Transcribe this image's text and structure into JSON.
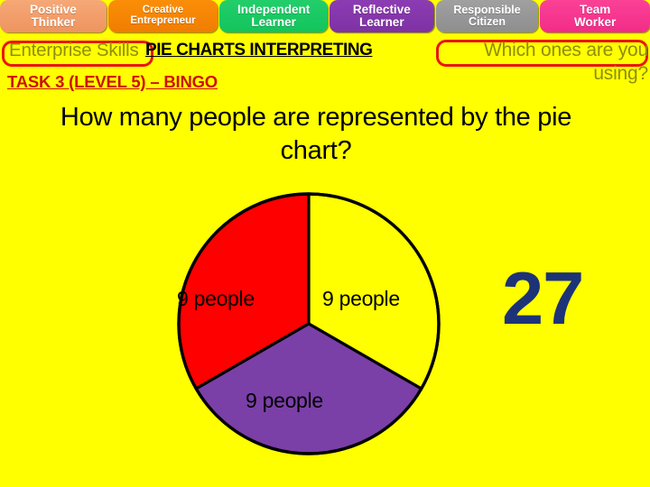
{
  "background_color": "#FFFF00",
  "skills_banner": {
    "items": [
      {
        "line1": "Positive",
        "line2": "Thinker",
        "color": "#EE9460",
        "name": "positive-thinker"
      },
      {
        "line1": "Creative",
        "line2": "Entrepreneur",
        "color": "#F07D00",
        "name": "creative-entrepreneur"
      },
      {
        "line1": "Independent",
        "line2": "Learner",
        "color": "#13C45C",
        "name": "independent-learner"
      },
      {
        "line1": "Reflective",
        "line2": "Learner",
        "color": "#7E31A4",
        "name": "reflective-learner"
      },
      {
        "line1": "Responsible",
        "line2": "Citizen",
        "color": "#8E8E8E",
        "name": "responsible-citizen"
      },
      {
        "line1": "Team",
        "line2": "Worker",
        "color": "#F22C88",
        "name": "team-worker"
      }
    ]
  },
  "headings": {
    "enterprise_skills": "Enterprise Skills",
    "enterprise_skills_color": "#8E8E0A",
    "topic_title": "PIE CHARTS INTERPRETING",
    "topic_title_color": "#000000",
    "task_line": "TASK 3 (LEVEL 5) – BINGO",
    "task_line_color": "#CC1100",
    "which_ones_prompt": "Which ones are you using?",
    "which_ones_color": "#8E8E0A",
    "outline_color": "#E8170E"
  },
  "question": {
    "text": "How many people are represented by the pie chart?",
    "color": "#000000"
  },
  "answer": {
    "value": "27",
    "color": "#1D3377"
  },
  "chart_data": {
    "type": "pie",
    "title": "",
    "labels": [
      "9 people",
      "9 people",
      "9 people"
    ],
    "values": [
      9,
      9,
      9
    ],
    "total": 27,
    "unit": "people",
    "percentages": [
      33.3,
      33.3,
      33.3
    ],
    "slice_colors": [
      "#FF0000",
      "#FFFF00",
      "#7B3FA8"
    ],
    "slice_names": [
      "red-slice",
      "yellow-slice",
      "purple-slice"
    ],
    "outline_color": "#000000",
    "legend": "none",
    "grid": false,
    "start_angle_deg": 0,
    "direction": "clockwise",
    "labels_inside": true
  }
}
